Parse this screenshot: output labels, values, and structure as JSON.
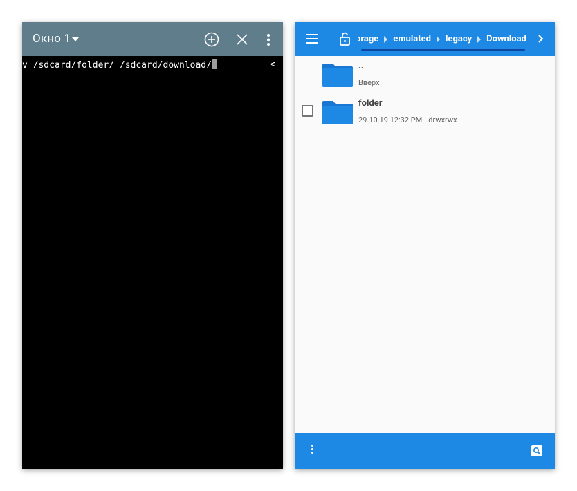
{
  "terminal": {
    "window_title": "Окно 1",
    "command_line": "v /sdcard/folder/ /sdcard/download/",
    "right_marker": "<",
    "toolbar_icons": [
      "add-circle-icon",
      "close-icon",
      "more-vert-icon"
    ],
    "colors": {
      "toolbar": "#607d8b",
      "screen": "#000000",
      "text": "#ffffff"
    }
  },
  "file_manager": {
    "breadcrumb": [
      "orage",
      "emulated",
      "legacy",
      "Download"
    ],
    "header_icons": [
      "menu-icon",
      "lock-open-icon",
      "chevron-right-icon"
    ],
    "rows": [
      {
        "name": "..",
        "subtitle": "Вверх"
      },
      {
        "name": "folder",
        "date": "29.10.19 12:32 PM",
        "permissions": "drwxrwx---"
      }
    ],
    "bottom_icons": [
      "more-vert-icon",
      "search-icon"
    ],
    "colors": {
      "accent": "#1e88e5",
      "folder": "#1976d2",
      "background": "#fafafa"
    }
  }
}
